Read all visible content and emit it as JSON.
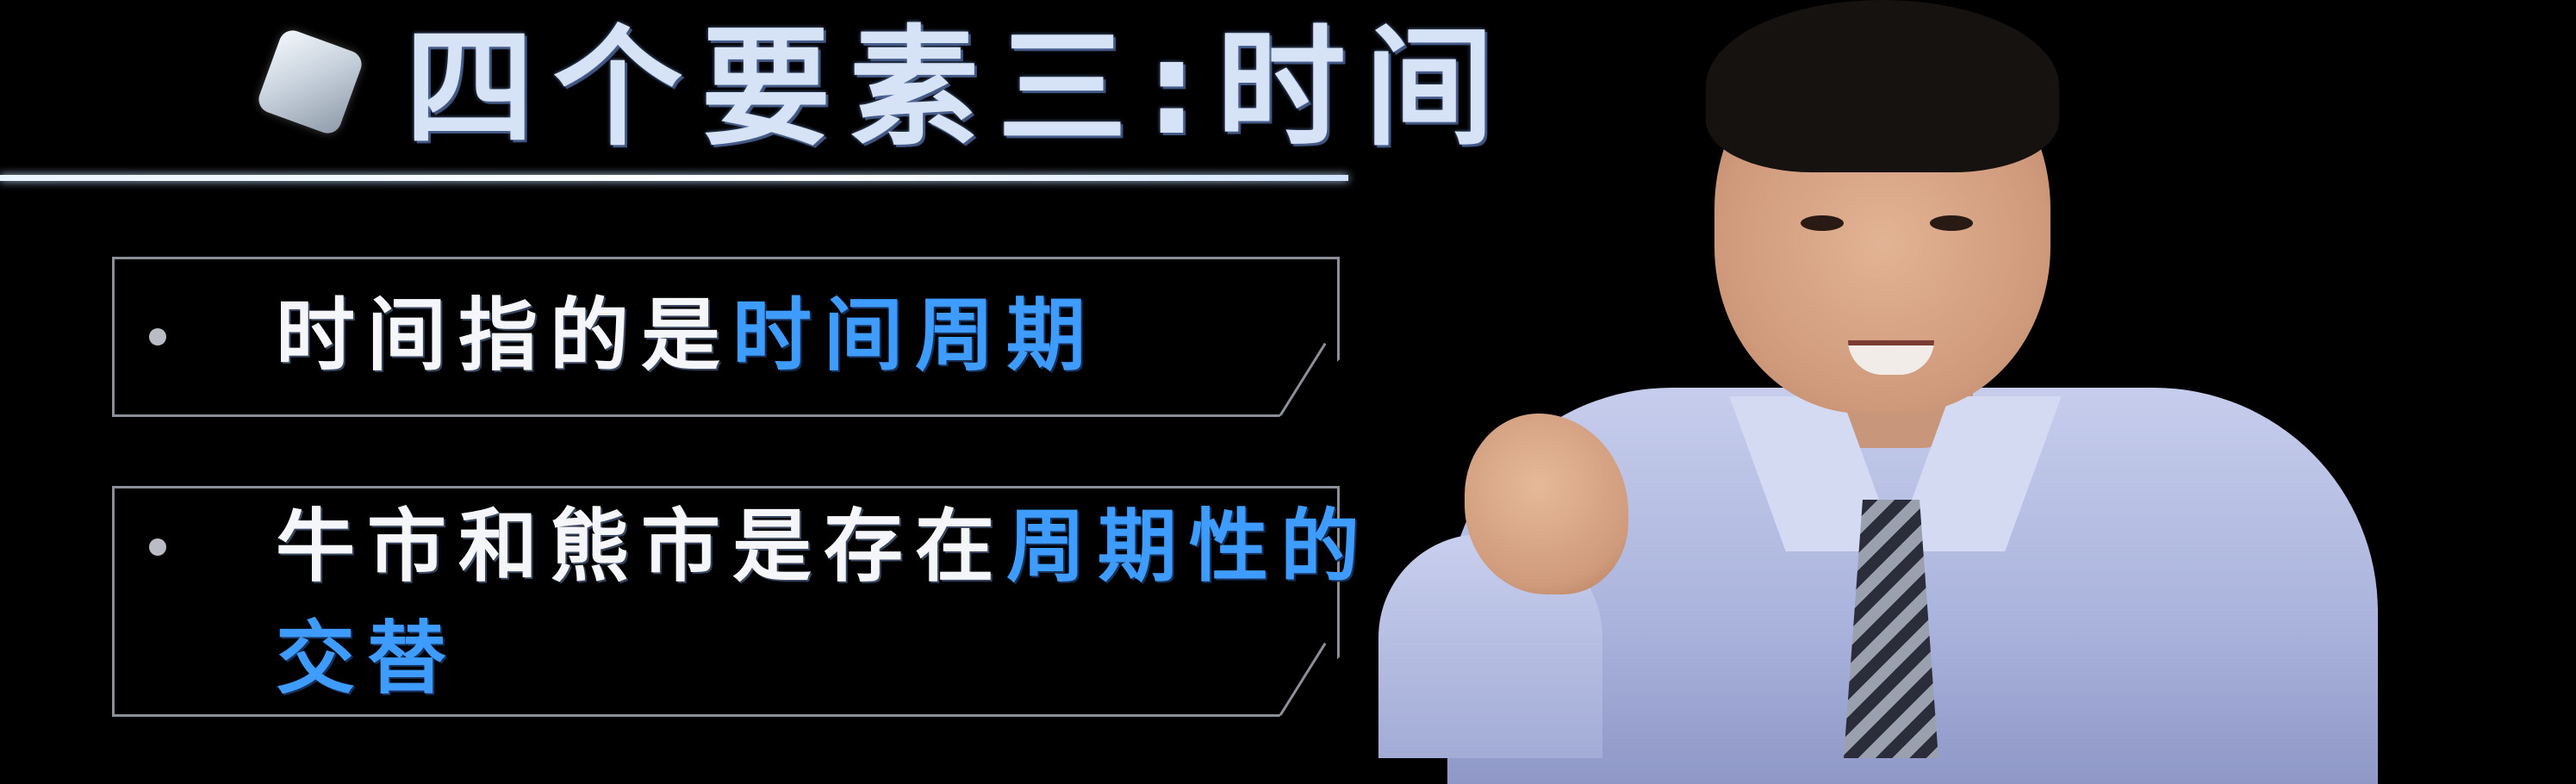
{
  "title": {
    "text": "四个要素三:时间"
  },
  "bullets": [
    {
      "prefix": "时间指的是",
      "highlight": "时间周期",
      "suffix_line2": ""
    },
    {
      "prefix": "牛市和熊市是存在",
      "highlight": "周期性的",
      "line2_highlight": "交替"
    }
  ],
  "colors": {
    "background": "#000000",
    "title": "#d6e2f6",
    "text": "#f4f6fa",
    "highlight": "#3f9cff",
    "box_border": "#8b8f97",
    "shirt": "#aab3dc"
  },
  "icons": {
    "title_marker": "diamond-icon",
    "bullet_marker": "bullet-dot"
  }
}
